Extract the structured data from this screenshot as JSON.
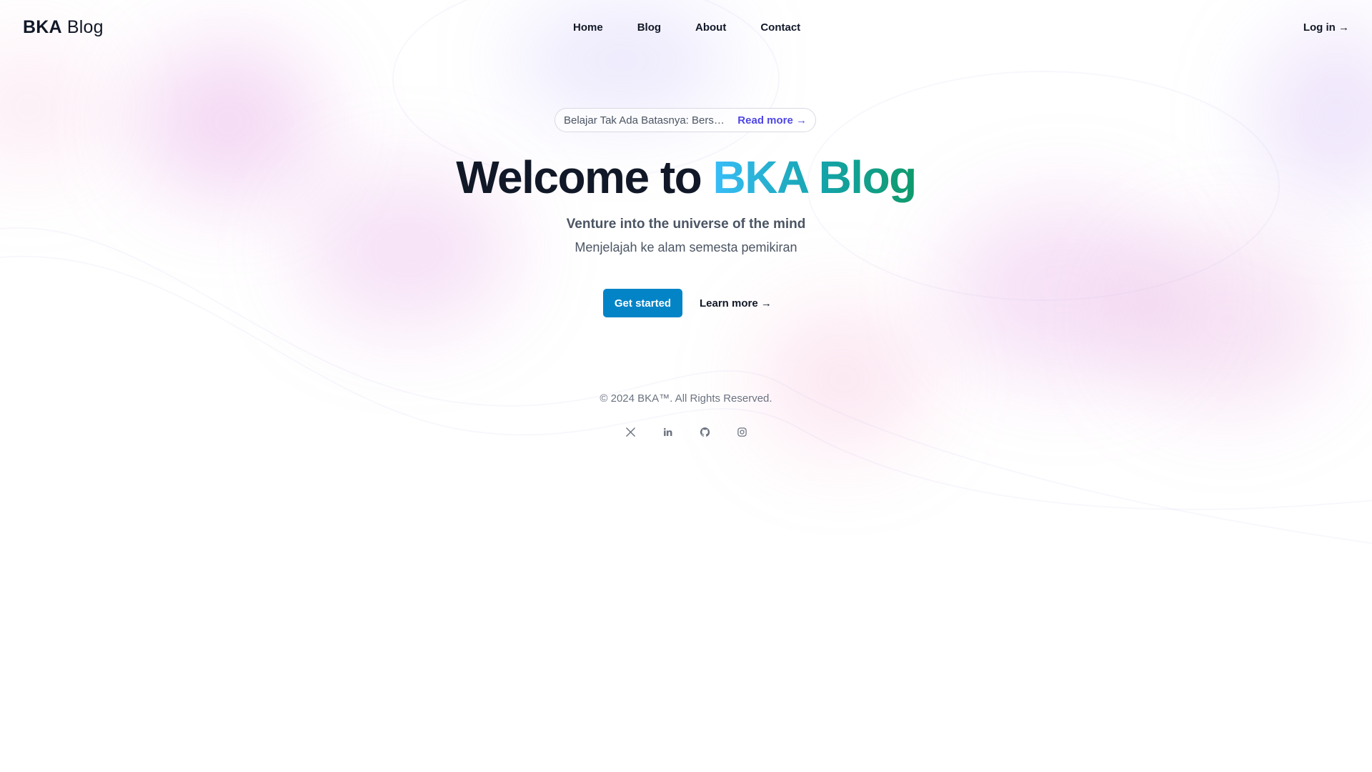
{
  "header": {
    "logo_bold": "BKA",
    "logo_light": "Blog",
    "nav": [
      {
        "label": "Home"
      },
      {
        "label": "Blog"
      },
      {
        "label": "About"
      },
      {
        "label": "Contact"
      }
    ],
    "login_label": "Log in →"
  },
  "hero": {
    "announcement_text": "Belajar Tak Ada Batasnya: Bersama Menjelajahi Dunia Ilmu",
    "announcement_link": "Read more →",
    "title_prefix": "Welcome to ",
    "title_highlight": "BKA Blog",
    "subtitle": "Venture into the universe of the mind",
    "subtitle_secondary": "Menjelajah ke alam semesta pemikiran",
    "primary_cta": "Get started",
    "secondary_cta": "Learn more →"
  },
  "footer": {
    "copyright": "© 2024 BKA™. All Rights Reserved.",
    "socials": [
      {
        "icon": "x-twitter-icon"
      },
      {
        "icon": "linkedin-icon"
      },
      {
        "icon": "github-icon"
      },
      {
        "icon": "instagram-icon"
      }
    ]
  },
  "colors": {
    "accent": "#0284c7",
    "link": "#4f46e5",
    "title_gradient_start": "#38bdf8",
    "title_gradient_end": "#0f9a6a"
  }
}
